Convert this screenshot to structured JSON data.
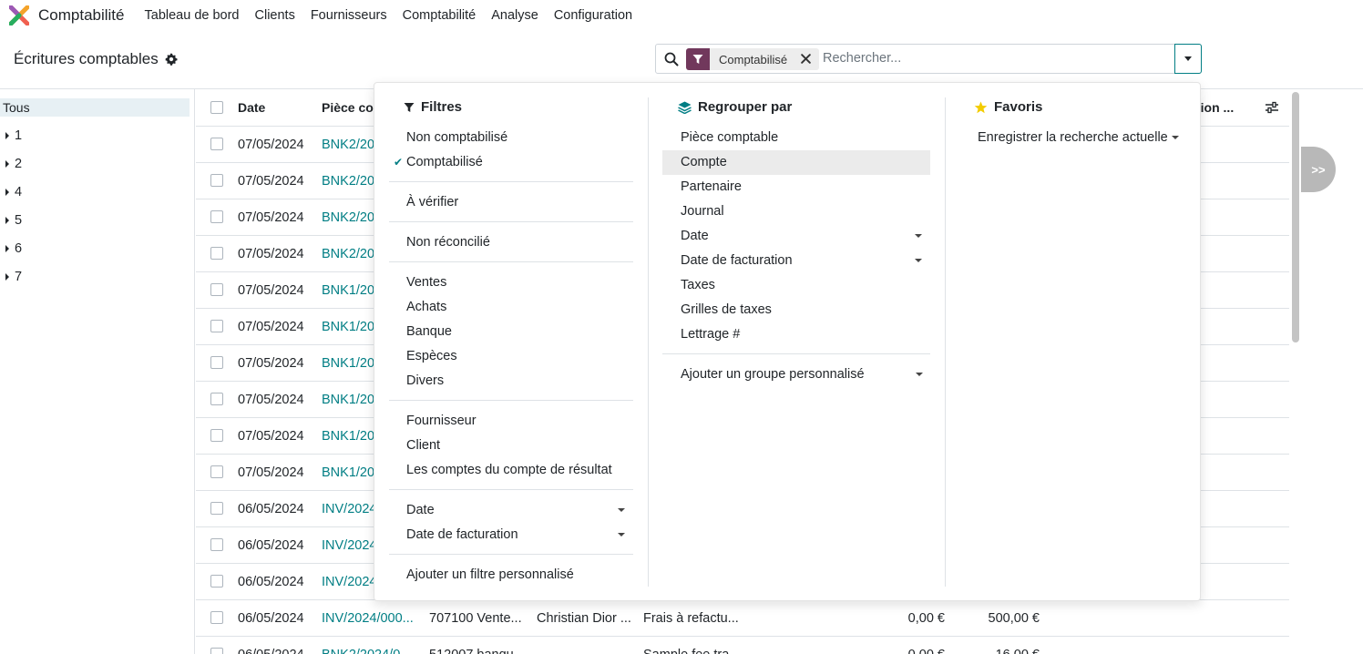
{
  "navbar": {
    "app_name": "Comptabilité",
    "menu": [
      "Tableau de bord",
      "Clients",
      "Fournisseurs",
      "Comptabilité",
      "Analyse",
      "Configuration"
    ]
  },
  "control_panel": {
    "title": "Écritures comptables",
    "facet_label": "Comptabilisé",
    "search_placeholder": "Rechercher..."
  },
  "side_panel": {
    "all_label": "Tous",
    "items": [
      "1",
      "2",
      "4",
      "5",
      "6",
      "7"
    ]
  },
  "table": {
    "headers": {
      "date": "Date",
      "piece": "Pièce co",
      "tail": "tion ..."
    },
    "rows": [
      {
        "date": "07/05/2024",
        "piece": "BNK2/20"
      },
      {
        "date": "07/05/2024",
        "piece": "BNK2/20"
      },
      {
        "date": "07/05/2024",
        "piece": "BNK2/20"
      },
      {
        "date": "07/05/2024",
        "piece": "BNK2/20"
      },
      {
        "date": "07/05/2024",
        "piece": "BNK1/20"
      },
      {
        "date": "07/05/2024",
        "piece": "BNK1/20"
      },
      {
        "date": "07/05/2024",
        "piece": "BNK1/20"
      },
      {
        "date": "07/05/2024",
        "piece": "BNK1/20"
      },
      {
        "date": "07/05/2024",
        "piece": "BNK1/20"
      },
      {
        "date": "07/05/2024",
        "piece": "BNK1/20"
      },
      {
        "date": "06/05/2024",
        "piece": "INV/2024"
      },
      {
        "date": "06/05/2024",
        "piece": "INV/2024"
      },
      {
        "date": "06/05/2024",
        "piece": "INV/2024"
      },
      {
        "date": "06/05/2024",
        "piece": "INV/2024/000...",
        "account": "707100 Vente...",
        "partner": "Christian Dior ...",
        "label": "Frais à refactu...",
        "debit": "0,00 €",
        "credit": "500,00 €"
      },
      {
        "date": "06/05/2024",
        "piece": "BNK2/2024/0...",
        "account": "512007 banqu...",
        "partner": "",
        "label": "Sample fee tra...",
        "debit": "0,00 €",
        "credit": "16,00 €"
      }
    ]
  },
  "dropdown": {
    "filters": {
      "title": "Filtres",
      "group1": [
        "Non comptabilisé",
        "Comptabilisé"
      ],
      "group2": [
        "À vérifier"
      ],
      "group3": [
        "Non réconcilié"
      ],
      "group4": [
        "Ventes",
        "Achats",
        "Banque",
        "Espèces",
        "Divers"
      ],
      "group5": [
        "Fournisseur",
        "Client",
        "Les comptes du compte de résultat"
      ],
      "group6": [
        "Date",
        "Date de facturation"
      ],
      "add_custom": "Ajouter un filtre personnalisé"
    },
    "groupby": {
      "title": "Regrouper par",
      "items": [
        "Pièce comptable",
        "Compte",
        "Partenaire",
        "Journal",
        "Date",
        "Date de facturation",
        "Taxes",
        "Grilles de taxes",
        "Lettrage #"
      ],
      "add_custom": "Ajouter un groupe personnalisé"
    },
    "favorites": {
      "title": "Favoris",
      "save_current": "Enregistrer la recherche actuelle"
    }
  },
  "chatter_toggle": ">>",
  "colors": {
    "accent": "#017e84",
    "brand": "#71385c"
  }
}
